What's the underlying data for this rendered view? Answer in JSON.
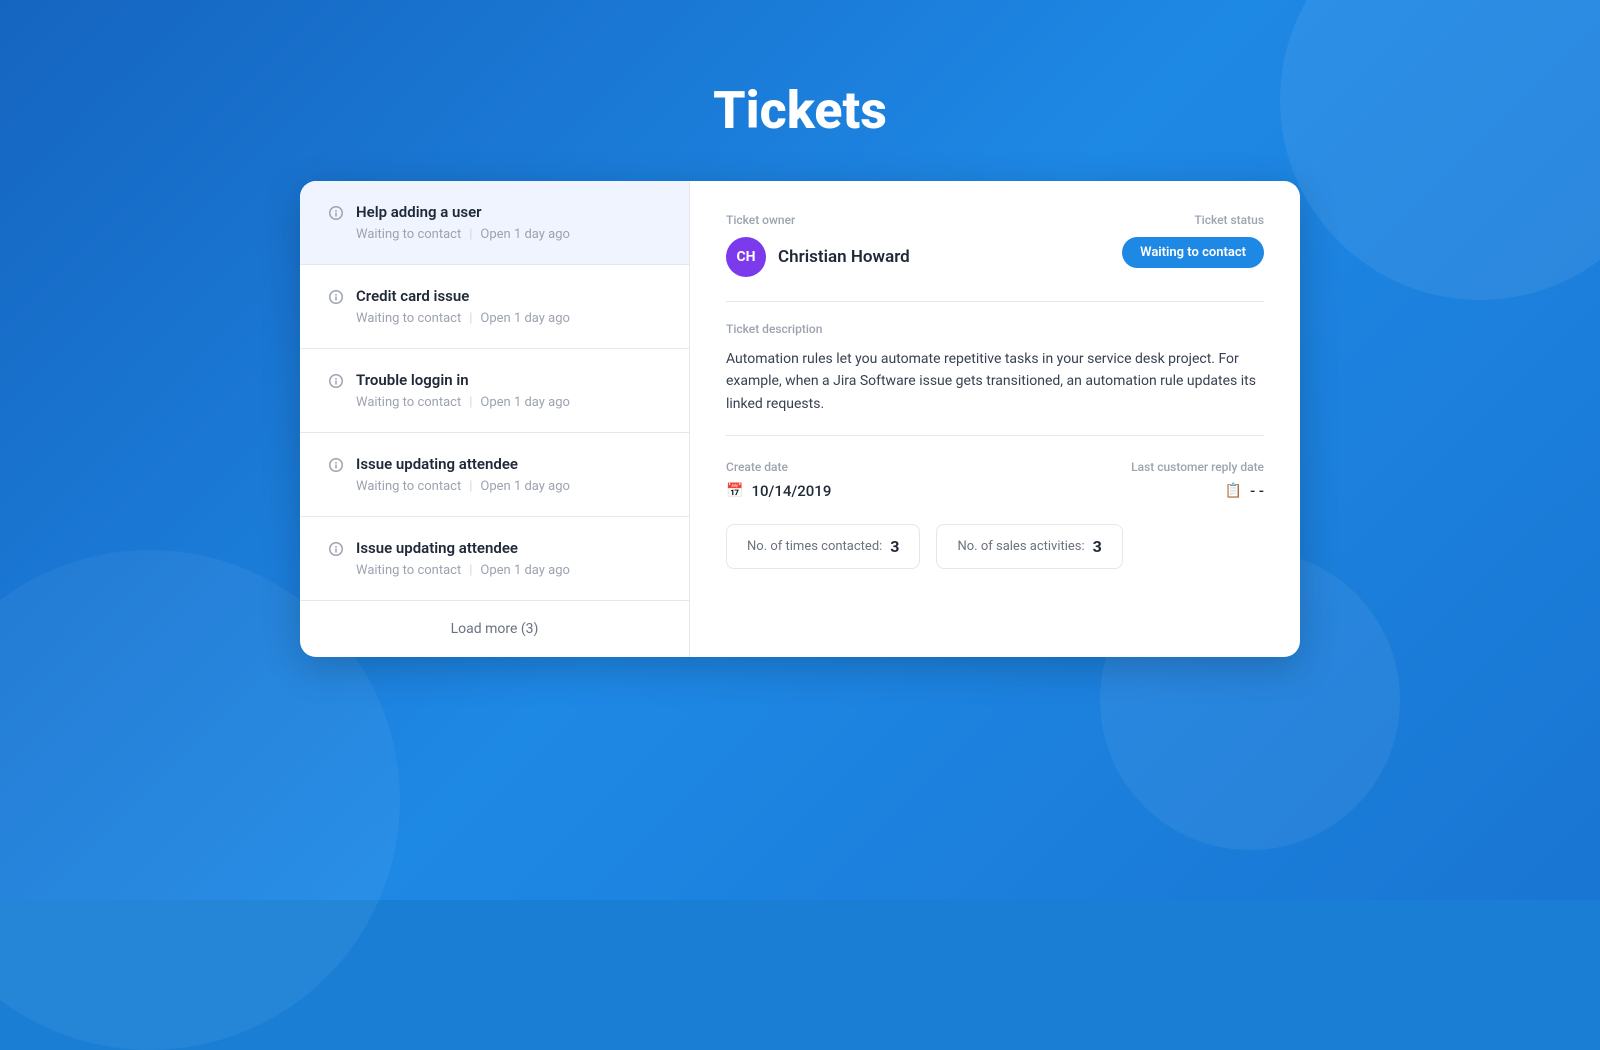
{
  "page": {
    "title": "Tickets",
    "background_color": "#1976d2"
  },
  "ticket_list": {
    "items": [
      {
        "id": "ticket-1",
        "title": "Help adding a user",
        "status": "Waiting to contact",
        "age": "Open 1 day ago",
        "active": true
      },
      {
        "id": "ticket-2",
        "title": "Credit card issue",
        "status": "Waiting to contact",
        "age": "Open 1 day ago",
        "active": false
      },
      {
        "id": "ticket-3",
        "title": "Trouble loggin in",
        "status": "Waiting to contact",
        "age": "Open 1 day ago",
        "active": false
      },
      {
        "id": "ticket-4",
        "title": "Issue updating attendee",
        "status": "Waiting to contact",
        "age": "Open 1 day ago",
        "active": false
      },
      {
        "id": "ticket-5",
        "title": "Issue updating attendee",
        "status": "Waiting to contact",
        "age": "Open 1 day ago",
        "active": false
      }
    ],
    "load_more_label": "Load more (3)"
  },
  "ticket_detail": {
    "owner_label": "Ticket owner",
    "owner_name": "Christian Howard",
    "owner_initials": "CH",
    "avatar_color": "#7c3aed",
    "status_label": "Ticket status",
    "status_value": "Waiting to contact",
    "status_color": "#1e88e5",
    "description_label": "Ticket description",
    "description_text": "Automation rules let you automate repetitive tasks in your service desk project. For example, when a Jira Software issue gets transitioned, an automation rule updates its linked requests.",
    "create_date_label": "Create date",
    "create_date_value": "10/14/2019",
    "last_reply_label": "Last customer reply date",
    "last_reply_value": "- -",
    "times_contacted_label": "No. of times contacted:",
    "times_contacted_value": "3",
    "sales_activities_label": "No. of sales activities:",
    "sales_activities_value": "3"
  }
}
